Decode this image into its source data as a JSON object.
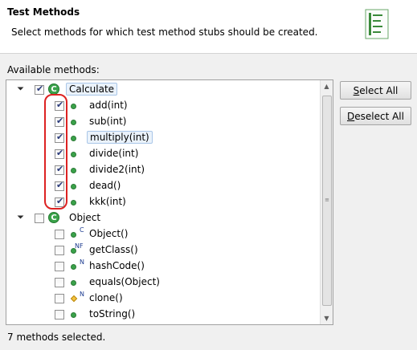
{
  "header": {
    "title": "Test Methods",
    "description": "Select methods for which test method stubs should be created."
  },
  "available_label": "Available methods:",
  "tree": {
    "items": [
      {
        "label": "Calculate",
        "kind": "class",
        "checked": true,
        "expanded": true,
        "selected": true
      },
      {
        "label": "add(int)",
        "kind": "method",
        "checked": true
      },
      {
        "label": "sub(int)",
        "kind": "method",
        "checked": true
      },
      {
        "label": "multiply(int)",
        "kind": "method",
        "checked": true,
        "selected": true
      },
      {
        "label": "divide(int)",
        "kind": "method",
        "checked": true
      },
      {
        "label": "divide2(int)",
        "kind": "method",
        "checked": true
      },
      {
        "label": "dead()",
        "kind": "method",
        "checked": true
      },
      {
        "label": "kkk(int)",
        "kind": "method",
        "checked": true
      },
      {
        "label": "Object",
        "kind": "class",
        "checked": false,
        "expanded": true
      },
      {
        "label": "Object()",
        "kind": "constructor",
        "checked": false,
        "modifier": "C"
      },
      {
        "label": "getClass()",
        "kind": "method",
        "checked": false,
        "modifier": "NF"
      },
      {
        "label": "hashCode()",
        "kind": "method",
        "checked": false,
        "modifier": "N"
      },
      {
        "label": "equals(Object)",
        "kind": "method",
        "checked": false
      },
      {
        "label": "clone()",
        "kind": "protected-method",
        "checked": false,
        "modifier": "N"
      },
      {
        "label": "toString()",
        "kind": "method",
        "checked": false
      }
    ]
  },
  "buttons": {
    "select_all_mnemonic": "S",
    "select_all_rest": "elect All",
    "deselect_all_mnemonic": "D",
    "deselect_all_rest": "eselect All"
  },
  "status": "7 methods selected.",
  "icons": {
    "header": "test-methods-wizard-icon",
    "class": "class-icon",
    "method": "public-method-icon",
    "protected": "protected-method-icon"
  },
  "colors": {
    "method_green": "#3aa24a",
    "annotation_red": "#dd2222",
    "selection_bg": "#eaf2fb"
  }
}
